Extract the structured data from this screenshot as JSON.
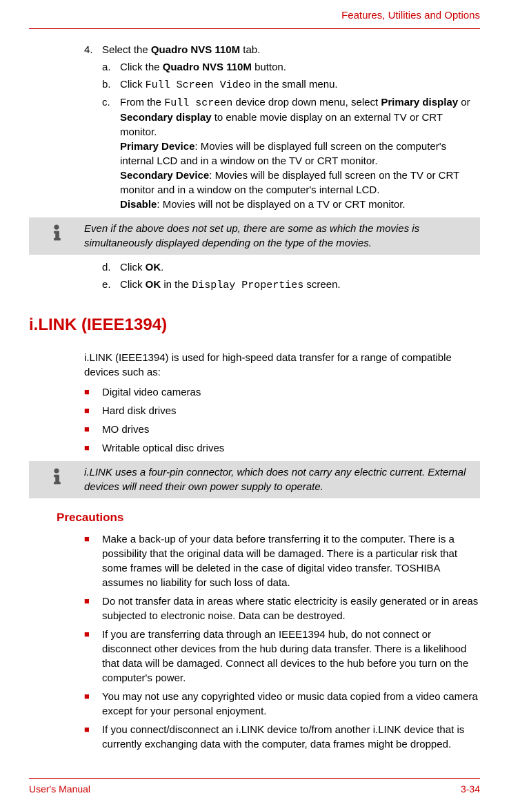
{
  "header": {
    "title": "Features, Utilities and Options"
  },
  "step4": {
    "num": "4.",
    "text_pre": "Select the ",
    "text_bold": "Quadro NVS 110M",
    "text_post": " tab."
  },
  "sub_a": {
    "letter": "a.",
    "pre": "Click the ",
    "bold": "Quadro NVS 110M",
    "post": " button."
  },
  "sub_b": {
    "letter": "b.",
    "pre": "Click ",
    "mono": "Full Screen Video",
    "post": " in the small menu."
  },
  "sub_c": {
    "letter": "c.",
    "l1_pre": "From the ",
    "l1_mono": "Full screen",
    "l1_mid": " device drop down menu, select ",
    "l1_bold1": "Primary display",
    "l1_or": " or ",
    "l1_bold2": "Secondary display",
    "l1_post": " to enable movie display on an external TV or CRT monitor.",
    "pd_label": "Primary Device",
    "pd_text": ": Movies will be displayed full screen on the computer's internal LCD and in a window on the TV or CRT monitor.",
    "sd_label": "Secondary Device",
    "sd_text": ": Movies will be displayed full screen on the TV or CRT monitor and in a window on the computer's internal LCD.",
    "dis_label": "Disable",
    "dis_text": ": Movies will not be displayed on a TV or CRT monitor."
  },
  "note1": "Even if the above does not set up, there are some as which the movies is simultaneously displayed depending on the type of the movies.",
  "sub_d": {
    "letter": "d.",
    "pre": "Click ",
    "bold": "OK",
    "post": "."
  },
  "sub_e": {
    "letter": "e.",
    "pre": "Click ",
    "bold": "OK",
    "mid": " in the ",
    "mono": "Display Properties",
    "post": " screen."
  },
  "ilink": {
    "heading": "i.LINK (IEEE1394)",
    "intro": "i.LINK (IEEE1394) is used for high-speed data transfer for a range of compatible devices such as:",
    "items": [
      "Digital video cameras",
      "Hard disk drives",
      "MO drives",
      "Writable optical disc drives"
    ]
  },
  "note2": "i.LINK uses a four-pin connector, which does not carry any electric current. External devices will need their own power supply to operate.",
  "precautions": {
    "heading": "Precautions",
    "items": [
      "Make a back-up of your data before transferring it to the computer. There is a possibility that the original data will be damaged. There is a particular risk that some frames will be deleted in the case of digital video transfer. TOSHIBA assumes no liability for such loss of data.",
      "Do not transfer data in areas where static electricity is easily generated or in areas subjected to electronic noise. Data can be destroyed.",
      "If you are transferring data through an IEEE1394 hub, do not connect or disconnect other devices from the hub during data transfer. There is a likelihood that data will be damaged. Connect all devices to the hub before you turn on the computer's power.",
      "You may not use any copyrighted video or music data copied from a video camera except for your personal enjoyment.",
      "If you connect/disconnect an i.LINK device to/from another i.LINK device that is currently exchanging data with the computer, data frames might be dropped."
    ]
  },
  "footer": {
    "left": "User's Manual",
    "right": "3-34"
  }
}
